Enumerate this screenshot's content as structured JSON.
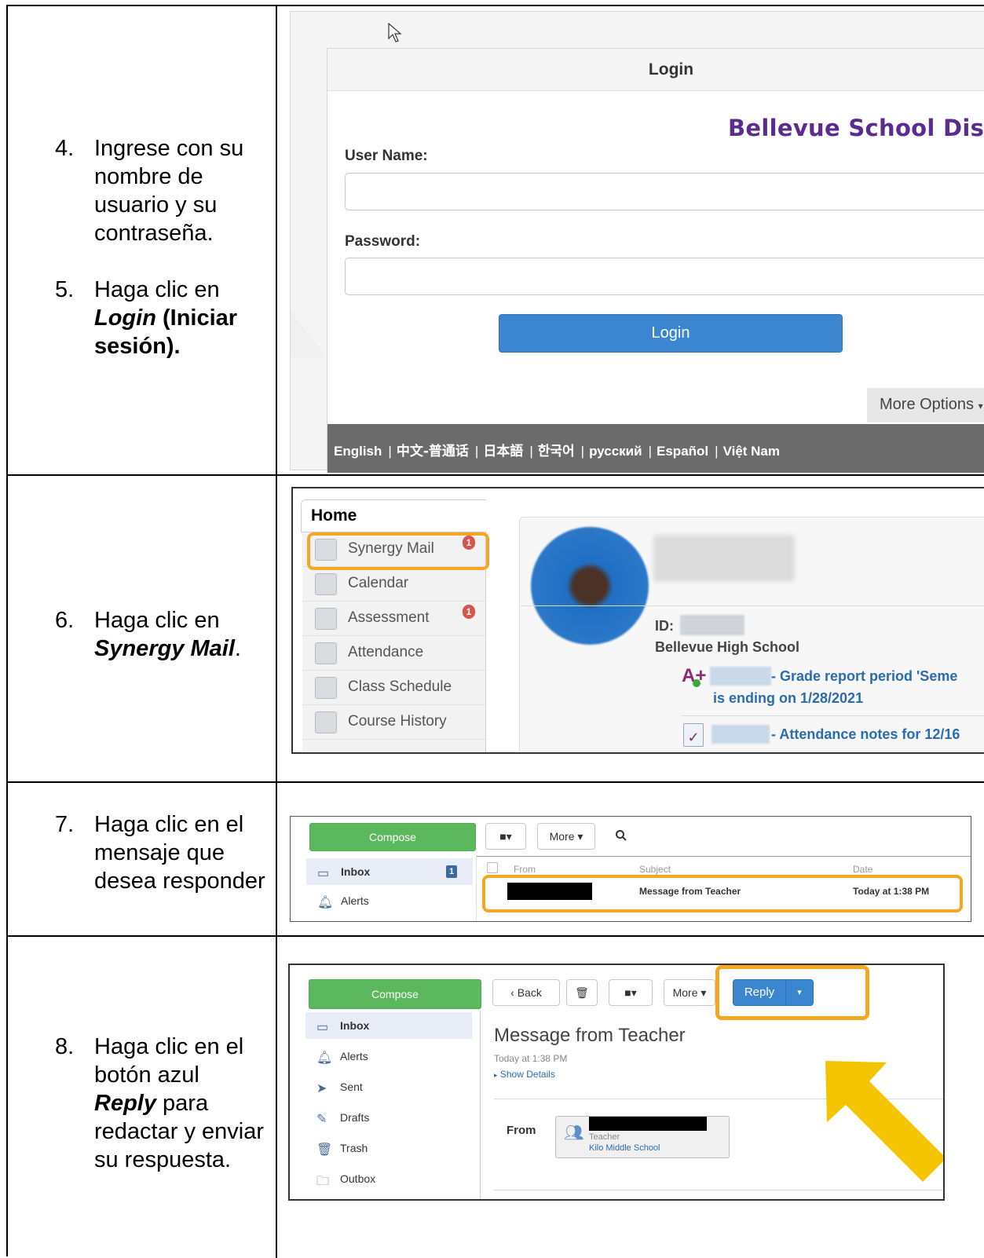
{
  "steps": [
    {
      "number": "4.",
      "text": "Ingrese con su nombre de usuario y su contraseña."
    },
    {
      "number": "5.",
      "pre": "Haga clic en",
      "emph": "Login",
      "post": "(Iniciar sesión)."
    },
    {
      "number": "6.",
      "pre": "Haga clic en",
      "emph": "Synergy Mail",
      "post": "."
    },
    {
      "number": "7.",
      "text": "Haga clic en el mensaje que desea responder"
    },
    {
      "number": "8.",
      "pre": "Haga clic en el botón azul",
      "emph": "Reply",
      "post": "para redactar y enviar su respuesta."
    }
  ],
  "login": {
    "title": "Login",
    "district": "Bellevue School District",
    "username_label": "User Name:",
    "password_label": "Password:",
    "button": "Login",
    "more_options": "More Options",
    "languages": [
      "English",
      "中文-普通话",
      "日本語",
      "한국어",
      "русский",
      "Español",
      "Việt Nam"
    ]
  },
  "home": {
    "tab": "Home",
    "menu": [
      {
        "label": "Synergy Mail",
        "icon": "mail-icon",
        "badge": "1"
      },
      {
        "label": "Calendar",
        "icon": "calendar-icon"
      },
      {
        "label": "Assessment",
        "icon": "chart-icon",
        "badge": "1"
      },
      {
        "label": "Attendance",
        "icon": "attendance-icon"
      },
      {
        "label": "Class Schedule",
        "icon": "schedule-icon"
      },
      {
        "label": "Course History",
        "icon": "books-icon"
      }
    ],
    "id_label": "ID:",
    "school": "Bellevue High School",
    "grade_note": "- Grade report period 'Seme",
    "grade_note_2": "is ending on 1/28/2021",
    "grade_icon_text": "A+",
    "attendance_note": "- Attendance notes for 12/16",
    "attendance_icon_text": "✓"
  },
  "mail_list": {
    "compose": "Compose",
    "more": "More ▾",
    "folder_menu": "■▾",
    "inbox": "Inbox",
    "inbox_count": "1",
    "alerts": "Alerts",
    "columns": [
      "From",
      "Subject",
      "Date"
    ],
    "row": {
      "subject": "Message from Teacher",
      "date": "Today at 1:38 PM"
    }
  },
  "reply_view": {
    "compose": "Compose",
    "back": "Back",
    "more": "More ▾",
    "folder_menu": "■▾",
    "reply": "Reply",
    "sidebar": [
      {
        "label": "Inbox",
        "icon": "inbox-icon"
      },
      {
        "label": "Alerts",
        "icon": "bell-icon"
      },
      {
        "label": "Sent",
        "icon": "sent-icon"
      },
      {
        "label": "Drafts",
        "icon": "pencil-icon"
      },
      {
        "label": "Trash",
        "icon": "trash-icon"
      },
      {
        "label": "Outbox",
        "icon": "folder-icon"
      }
    ],
    "title": "Message from Teacher",
    "date": "Today at 1:38 PM",
    "show_details": "Show Details",
    "from_label": "From",
    "from_role": "Teacher",
    "from_school": "Kilo Middle School"
  },
  "colors": {
    "highlight": "#f5a623",
    "arrow": "#f5c400",
    "compose_green": "#5cb85c",
    "reply_blue": "#3b86ce",
    "district_purple": "#5b2c8f"
  }
}
